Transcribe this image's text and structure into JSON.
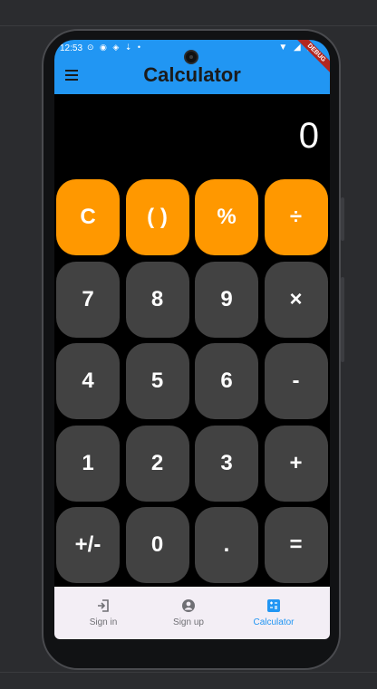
{
  "status_bar": {
    "time": "12:53",
    "debug_badge": "DEBUG"
  },
  "app_bar": {
    "title": "Calculator",
    "menu_icon": "hamburger-menu-icon"
  },
  "display": {
    "value": "0"
  },
  "keys": [
    [
      "C",
      "( )",
      "%",
      "÷"
    ],
    [
      "7",
      "8",
      "9",
      "×"
    ],
    [
      "4",
      "5",
      "6",
      "-"
    ],
    [
      "1",
      "2",
      "3",
      "+"
    ],
    [
      "+/-",
      "0",
      ".",
      "="
    ]
  ],
  "colors": {
    "app_bar": "#2196f3",
    "operator_key": "#ff9800",
    "number_key": "#424242",
    "active_nav": "#2196f3"
  },
  "bottom_nav": [
    {
      "label": "Sign in",
      "icon": "login-icon",
      "active": false
    },
    {
      "label": "Sign up",
      "icon": "account-circle-icon",
      "active": false
    },
    {
      "label": "Calculator",
      "icon": "calculate-icon",
      "active": true
    }
  ]
}
